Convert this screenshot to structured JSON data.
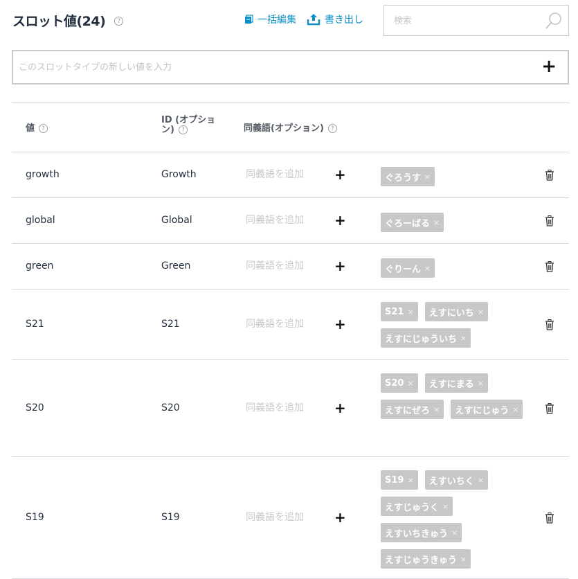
{
  "header": {
    "title": "スロット値(24)",
    "help": "?",
    "bulk_edit": "一括編集",
    "export": "書き出し",
    "search_placeholder": "検索"
  },
  "new_value": {
    "placeholder": "このスロットタイプの新しい値を入力",
    "add": "+"
  },
  "table": {
    "columns": {
      "value": "値",
      "id": "ID (オプション)",
      "synonyms": "同義語(オプション)"
    },
    "synonym_placeholder": "同義語を追加",
    "rows": [
      {
        "value": "growth",
        "id": "Growth",
        "synonyms": [
          "ぐろうす"
        ]
      },
      {
        "value": "global",
        "id": "Global",
        "synonyms": [
          "ぐろーばる"
        ]
      },
      {
        "value": "green",
        "id": "Green",
        "synonyms": [
          "ぐりーん"
        ]
      },
      {
        "value": "S21",
        "id": "S21",
        "synonyms": [
          "S21",
          "えすにいち",
          "えすにじゅういち"
        ]
      },
      {
        "value": "S20",
        "id": "S20",
        "synonyms": [
          "S20",
          "えすにまる",
          "えすにぜろ",
          "えすにじゅう"
        ]
      },
      {
        "value": "S19",
        "id": "S19",
        "synonyms": [
          "S19",
          "えすいちく",
          "えすじゅうく",
          "えすいちきゅう",
          "えすじゅうきゅう"
        ]
      }
    ]
  },
  "icons": {
    "bulk_edit": "bulk-edit-icon",
    "export": "upload-icon",
    "search": "search-icon",
    "delete": "trash-icon"
  },
  "colors": {
    "link": "#0a8fc4",
    "tag_bg": "#c8c8c8"
  }
}
